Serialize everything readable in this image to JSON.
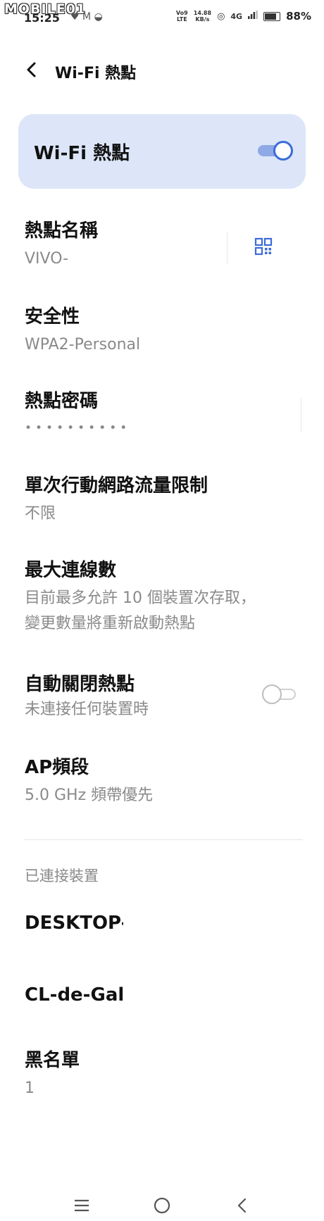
{
  "status_bar": {
    "watermark": "MOBILE01",
    "time": "15:25",
    "network_top": "Vo9",
    "network_bottom": "LTE",
    "speed_value": "14.88",
    "speed_unit": "KB/s",
    "cellular": "4G",
    "battery_percent": 88,
    "battery_text": "88%"
  },
  "header": {
    "title": "Wi-Fi 熱點"
  },
  "hotspot_toggle": {
    "label": "Wi-Fi 熱點",
    "enabled": true
  },
  "settings": {
    "name": {
      "title": "熱點名稱",
      "value": "VIVO-"
    },
    "security": {
      "title": "安全性",
      "value": "WPA2-Personal"
    },
    "password": {
      "title": "熱點密碼",
      "value": "••••••••••"
    },
    "data_limit": {
      "title": "單次行動網路流量限制",
      "value": "不限"
    },
    "max_connections": {
      "title": "最大連線數",
      "line1": "目前最多允許 10 個裝置次存取，",
      "line2": "變更數量將重新啟動熱點"
    },
    "auto_off": {
      "title": "自動關閉熱點",
      "value": "未連接任何裝置時",
      "enabled": false
    },
    "ap_band": {
      "title": "AP頻段",
      "value": "5.0 GHz 頻帶優先"
    }
  },
  "connected_devices": {
    "label": "已連接裝置",
    "devices": [
      "DESKTOP-",
      "CL-de-Gala"
    ]
  },
  "blacklist": {
    "title": "黑名單",
    "value": "1"
  },
  "colors": {
    "accent": "#3d6bd8",
    "card_bg": "#dde6f8",
    "secondary_text": "#8a8a8a"
  }
}
